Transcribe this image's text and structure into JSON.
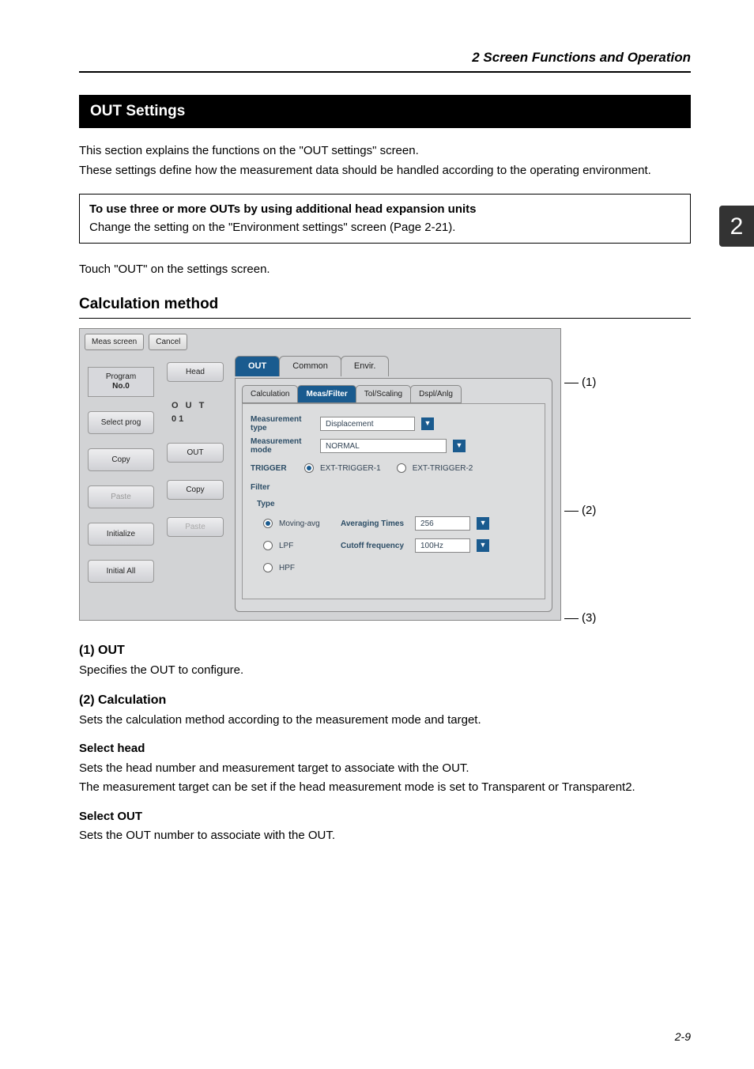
{
  "doc": {
    "header": "2  Screen Functions and Operation",
    "sideTab": "2",
    "pageNum": "2-9"
  },
  "title": "OUT Settings",
  "intro1": "This section explains the functions on the \"OUT settings\" screen.",
  "intro2": "These settings define how the measurement data should be handled according to the operating environment.",
  "infobox": {
    "title": "To use three or more OUTs by using additional head expansion units",
    "body": "Change the setting on the \"Environment settings\" screen (Page 2-21)."
  },
  "touchLine": "Touch \"OUT\" on the settings screen.",
  "subsection": "Calculation method",
  "annotations": {
    "a1": "(1)",
    "a2": "(2)",
    "a3": "(3)"
  },
  "ui": {
    "topbar": {
      "measScreen": "Meas screen",
      "cancel": "Cancel"
    },
    "leftPanel": {
      "program": "Program",
      "programNo": "No.0",
      "selectProg": "Select prog",
      "copy": "Copy",
      "paste": "Paste",
      "initialize": "Initialize",
      "initialAll": "Initial All"
    },
    "col2": {
      "head": "Head",
      "ou_t01": "O U T 01",
      "out": "OUT",
      "copy": "Copy",
      "paste": "Paste"
    },
    "tabs": {
      "out": "OUT",
      "common": "Common",
      "envir": "Envir."
    },
    "subtabs": {
      "calc": "Calculation",
      "measFilter": "Meas/Filter",
      "tolScaling": "Tol/Scaling",
      "dsplAnlg": "Dspl/Anlg"
    },
    "fields": {
      "measTypeLabel": "Measurement type",
      "measTypeValue": "Displacement",
      "measModeLabel": "Measurement mode",
      "measModeValue": "NORMAL",
      "triggerLabel": "TRIGGER",
      "extTrig1": "EXT-TRIGGER-1",
      "extTrig2": "EXT-TRIGGER-2",
      "filterLabel": "Filter",
      "typeLabel": "Type",
      "movingAvg": "Moving-avg",
      "lpf": "LPF",
      "hpf": "HPF",
      "avgTimesLabel": "Averaging Times",
      "avgTimesValue": "256",
      "cutoffLabel": "Cutoff frequency",
      "cutoffValue": "100Hz"
    }
  },
  "sections": {
    "s1h": "(1) OUT",
    "s1b": "Specifies the OUT to configure.",
    "s2h": "(2) Calculation",
    "s2b": "Sets the calculation method according to the measurement mode and target.",
    "selHeadH": "Select head",
    "selHeadB1": "Sets the head number and measurement target to associate with the OUT.",
    "selHeadB2": "The measurement target can be set if the head measurement mode is set to Transparent or Transparent2.",
    "selOutH": "Select OUT",
    "selOutB": "Sets the OUT number to associate with the OUT."
  }
}
